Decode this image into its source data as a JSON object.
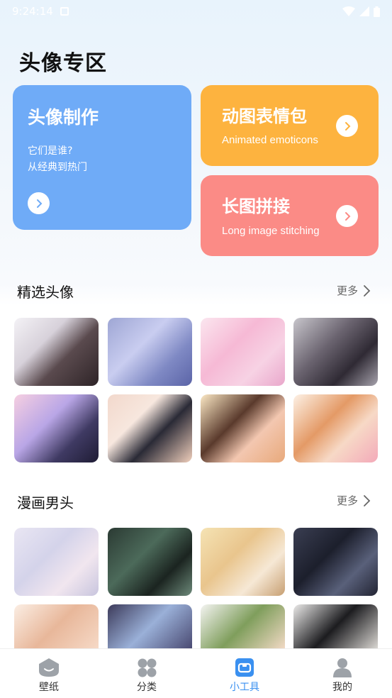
{
  "status_bar": {
    "time": "9:24:14"
  },
  "page_title": "头像专区",
  "cards": {
    "avatar_make": {
      "title": "头像制作",
      "subtitle_line1": "它们是谁?",
      "subtitle_line2": "从经典到热门"
    },
    "animated": {
      "title": "动图表情包",
      "subtitle": "Animated emoticons"
    },
    "stitching": {
      "title": "长图拼接",
      "subtitle": "Long image stitching"
    }
  },
  "sections": [
    {
      "title": "精选头像",
      "more": "更多"
    },
    {
      "title": "漫画男头",
      "more": "更多"
    }
  ],
  "tabs": [
    {
      "label": "壁纸",
      "icon": "wallpaper-icon",
      "active": false
    },
    {
      "label": "分类",
      "icon": "category-icon",
      "active": false
    },
    {
      "label": "小工具",
      "icon": "tools-icon",
      "active": true
    },
    {
      "label": "我的",
      "icon": "profile-icon",
      "active": false
    }
  ],
  "colors": {
    "card_blue": "#6fabf7",
    "card_orange": "#fdb33f",
    "card_red": "#fb8b86",
    "tab_active": "#3a90f0"
  }
}
